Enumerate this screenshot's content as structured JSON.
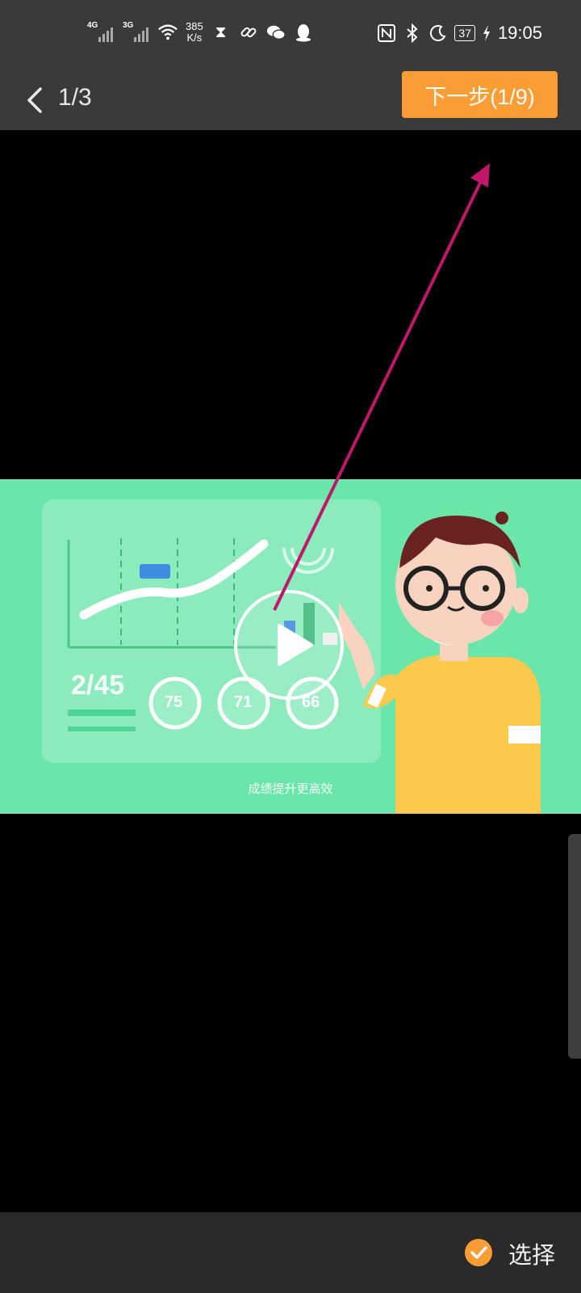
{
  "status_bar": {
    "net_speed_value": "385",
    "net_speed_unit": "K/s",
    "battery": "37",
    "time": "19:05",
    "sim1_label": "4G",
    "sim2_label": "3G",
    "icons": [
      "signal-4g-icon",
      "signal-3g-icon",
      "wifi-icon",
      "hourglass-icon",
      "link-icon",
      "wechat-icon",
      "qq-icon",
      "nfc-icon",
      "bluetooth-icon",
      "moon-icon",
      "battery-icon",
      "charging-icon"
    ]
  },
  "nav": {
    "page_counter": "1/3",
    "next_button_label": "下一步(1/9)"
  },
  "video": {
    "score": "2/45",
    "gauges": [
      "75",
      "71",
      "66"
    ],
    "caption": "成绩提升更高效"
  },
  "bottom": {
    "select_label": "选择"
  },
  "colors": {
    "accent": "#fa9d35",
    "bar_bg": "#3a3a3a",
    "thumb_bg": "#6be6aa",
    "annotation_arrow": "#c0176a"
  }
}
